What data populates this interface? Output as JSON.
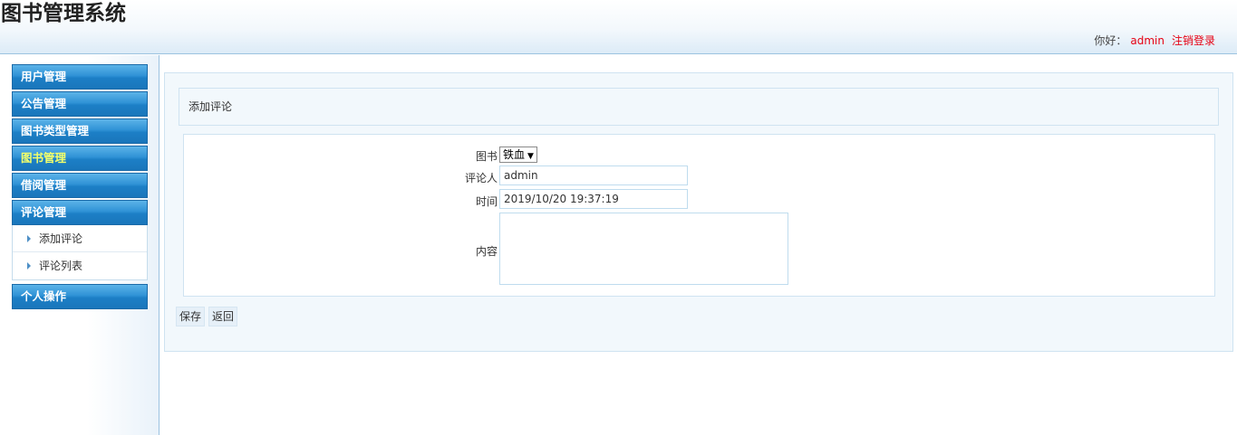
{
  "app": {
    "title": "图书管理系统"
  },
  "header": {
    "greeting": "你好：",
    "username": "admin",
    "logout": "注销登录"
  },
  "sidebar": {
    "menus": [
      {
        "label": "用户管理"
      },
      {
        "label": "公告管理"
      },
      {
        "label": "图书类型管理"
      },
      {
        "label": "图书管理"
      },
      {
        "label": "借阅管理"
      },
      {
        "label": "评论管理"
      },
      {
        "label": "个人操作"
      }
    ],
    "comment_submenu": [
      {
        "label": "添加评论"
      },
      {
        "label": "评论列表"
      }
    ],
    "active_color": "#f3ff6a"
  },
  "main": {
    "panel_title": "添加评论",
    "form": {
      "book_label": "图书",
      "book_value": "铁血",
      "reviewer_label": "评论人",
      "reviewer_value": "admin",
      "time_label": "时间",
      "time_value": "2019/10/20 19:37:19",
      "content_label": "内容",
      "content_value": ""
    },
    "buttons": {
      "save": "保存",
      "back": "返回"
    }
  },
  "colors": {
    "accent": "#1c7fc6",
    "link_red": "#e60012"
  }
}
